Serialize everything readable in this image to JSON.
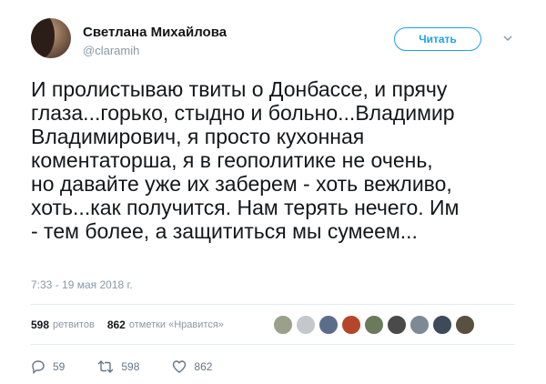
{
  "author": {
    "name": "Светлана Михайлова",
    "handle": "@claramih"
  },
  "follow_button": {
    "label": "Читать"
  },
  "tweet": {
    "text": "И пролистываю  твиты о Донбассе, и прячу\nглаза...горько, стыдно и больно...Владимир\nВладимирович, я просто кухонная\nкоментаторша, я в геополитике не очень,\nно давайте уже их заберем - хоть вежливо,\nхоть...как получится. Нам терять нечего. Им\n- тем более, а защититься мы сумеем...",
    "timestamp": "7:33 - 19 мая 2018 г."
  },
  "stats": {
    "retweets_count": "598",
    "retweets_label": "ретвитов",
    "likes_count": "862",
    "likes_label": "отметки «Нравится»"
  },
  "liker_avatar_colors": [
    "#9aa08a",
    "#c4c8cc",
    "#5a6e8c",
    "#b5462a",
    "#6b7a5c",
    "#4a4a4a",
    "#7d8a96",
    "#3c4a5a",
    "#5a5040"
  ],
  "actions": {
    "reply_count": "59",
    "retweet_count": "598",
    "like_count": "862"
  },
  "icons": {
    "avatar": "user-avatar",
    "chevron": "chevron-down-icon",
    "reply": "reply-icon",
    "retweet": "retweet-icon",
    "like": "heart-icon"
  },
  "colors": {
    "accent": "#1da1f2",
    "muted": "#8899a6",
    "text": "#14171a"
  }
}
